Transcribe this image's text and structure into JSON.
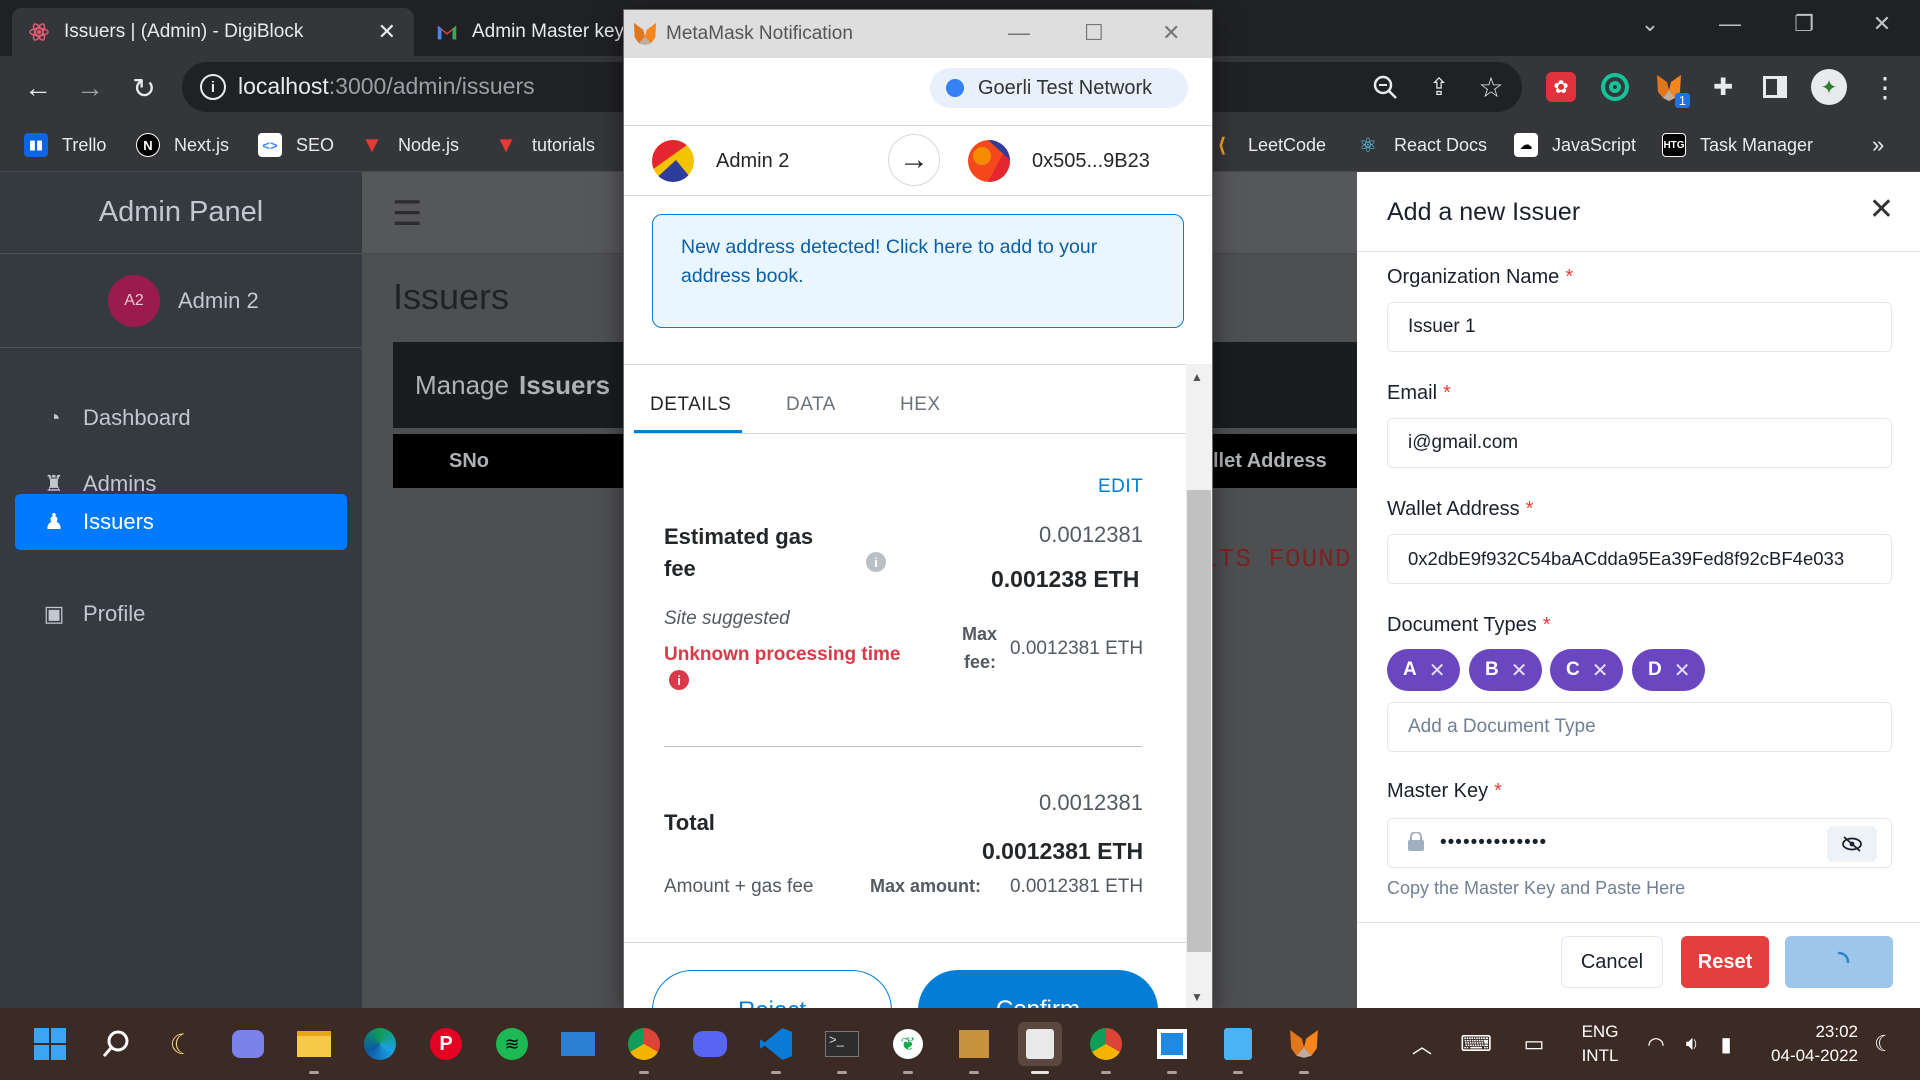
{
  "browser": {
    "tabs": [
      {
        "title": "Issuers | (Admin) - DigiBlock",
        "active": true
      },
      {
        "title": "Admin Master key",
        "active": false
      }
    ],
    "url_host": "localhost",
    "url_path": ":3000/admin/issuers",
    "bookmarks": [
      "Trello",
      "Next.js",
      "SEO",
      "Node.js",
      "tutorials",
      "LeetCode",
      "React Docs",
      "JavaScript",
      "Task Manager"
    ],
    "bookmark_overflow": "»",
    "extension_badge": "1"
  },
  "sidebar": {
    "brand": "Admin Panel",
    "user_initials": "A2",
    "user_name": "Admin 2",
    "items": [
      {
        "label": "Dashboard",
        "icon": "dashboard-icon",
        "active": false
      },
      {
        "label": "Admins",
        "icon": "admins-icon",
        "active": false
      },
      {
        "label": "Issuers",
        "icon": "user-icon",
        "active": true
      },
      {
        "label": "Profile",
        "icon": "profile-icon",
        "active": false
      }
    ]
  },
  "main": {
    "page_title": "Issuers",
    "card_prefix": "Manage",
    "card_bold": "Issuers",
    "columns": [
      "SNo",
      "llet Address"
    ],
    "empty_text": "LTS FOUND"
  },
  "drawer": {
    "title": "Add a new Issuer",
    "org_label": "Organization Name",
    "org_value": "Issuer 1",
    "email_label": "Email",
    "email_value": "i@gmail.com",
    "wallet_label": "Wallet Address",
    "wallet_value": "0x2dbE9f932C54baACdda95Ea39Fed8f92cBF4e033",
    "doc_label": "Document Types",
    "doc_tags": [
      "A",
      "B",
      "C",
      "D"
    ],
    "doc_placeholder": "Add a Document Type",
    "key_label": "Master Key",
    "key_value": "••••••••••••••",
    "key_helper": "Copy the Master Key and Paste Here",
    "required_mark": "*",
    "cancel_label": "Cancel",
    "reset_label": "Reset"
  },
  "metamask": {
    "window_title": "MetaMask Notification",
    "network": "Goerli Test Network",
    "from_account": "Admin 2",
    "to_account": "0x505...9B23",
    "notice": "New address detected! Click here to add to your address book.",
    "tabs": [
      "DETAILS",
      "DATA",
      "HEX"
    ],
    "edit_label": "EDIT",
    "gas_label_1": "Estimated gas",
    "gas_label_2": "fee",
    "gas_value_small": "0.0012381",
    "gas_value_bold": "0.001238 ETH",
    "site_suggested": "Site suggested",
    "unknown_time": "Unknown processing time",
    "max_fee_label_1": "Max",
    "max_fee_label_2": "fee:",
    "max_fee_value": "0.0012381 ETH",
    "total_label": "Total",
    "total_value_small": "0.0012381",
    "total_value_bold": "0.0012381 ETH",
    "amount_gas_label": "Amount + gas fee",
    "max_amount_label": "Max amount:",
    "max_amount_value": "0.0012381 ETH",
    "reject_label": "Reject",
    "confirm_label": "Confirm"
  },
  "taskbar": {
    "lang_1": "ENG",
    "lang_2": "INTL",
    "time": "23:02",
    "date": "04-04-2022"
  },
  "colors": {
    "sidebar_bg": "#343a40",
    "active_nav": "#007bff",
    "tag_purple": "#6b46c1",
    "reset_red": "#e53e3e",
    "metamask_blue": "#037dd6",
    "unknown_red": "#d73a49"
  }
}
